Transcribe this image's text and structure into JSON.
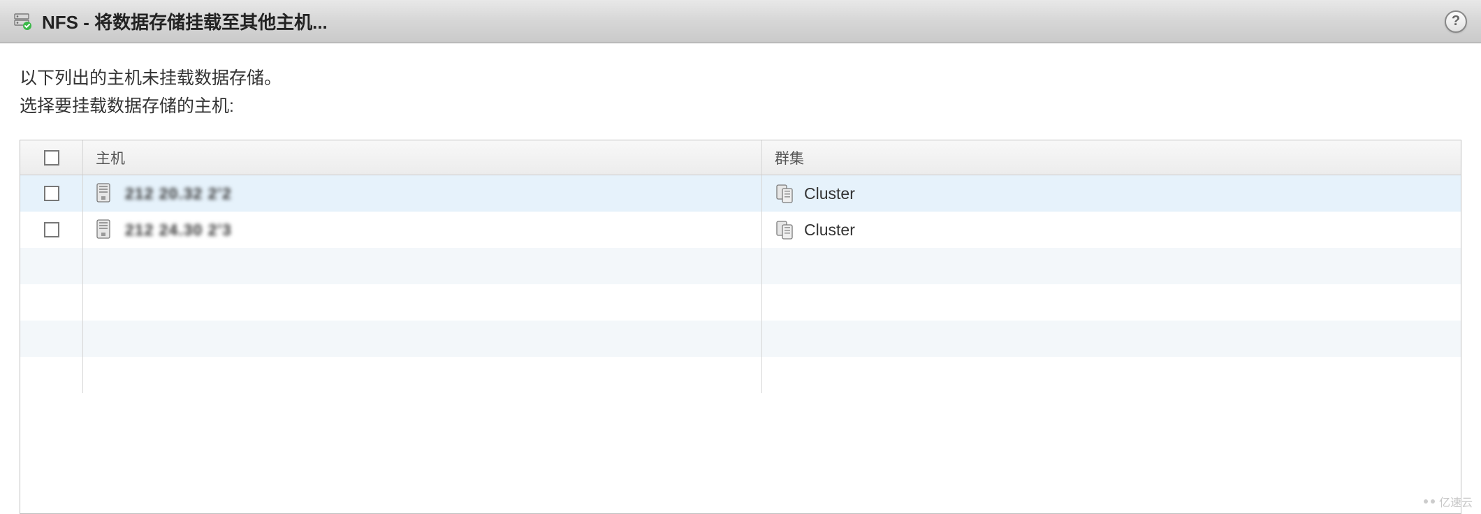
{
  "dialog": {
    "title": "NFS - 将数据存储挂载至其他主机...",
    "help_glyph": "?"
  },
  "instructions": {
    "line1": "以下列出的主机未挂载数据存储。",
    "line2": "选择要挂载数据存储的主机:"
  },
  "table": {
    "columns": {
      "host": "主机",
      "cluster": "群集"
    },
    "rows": [
      {
        "host": "212 20.32 2'2",
        "cluster": "Cluster",
        "obscured": true
      },
      {
        "host": "212 24.30 2'3",
        "cluster": "Cluster",
        "obscured": true
      }
    ],
    "empty_rows": 4
  },
  "watermark": "亿速云"
}
